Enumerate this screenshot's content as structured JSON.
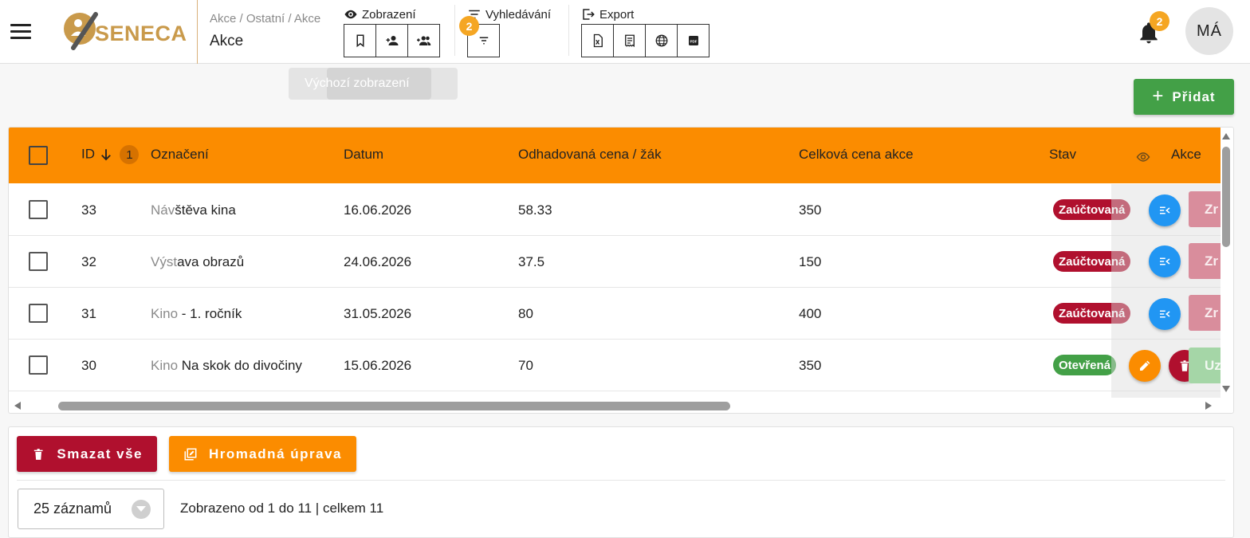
{
  "header": {
    "logo_text": "SENECA",
    "breadcrumb": "Akce / Ostatní / Akce",
    "page_title": "Akce",
    "view_group_label": "Zobrazení",
    "search_group_label": "Vyhledávání",
    "search_filter_count": "2",
    "export_group_label": "Export",
    "notification_count": "2",
    "user_initials": "MÁ"
  },
  "tooltip": {
    "text": "Výchozí zobrazení"
  },
  "add_button": {
    "label": "Přidat"
  },
  "table": {
    "columns": {
      "id": "ID",
      "id_sort_order": "1",
      "label": "Označení",
      "date": "Datum",
      "estimated_price": "Odhadovaná cena / žák",
      "total_price": "Celková cena akce",
      "status": "Stav",
      "actions": "Akce"
    },
    "rows": [
      {
        "id": "33",
        "label_prefix": "Náv",
        "label_rest": "štěva kina",
        "date": "16.06.2026",
        "estimated_price": "58.33",
        "total_price": "350",
        "status": "Zaúčtovaná",
        "cut_label": "Zr"
      },
      {
        "id": "32",
        "label_prefix": "Výst",
        "label_rest": "ava obrazů",
        "date": "24.06.2026",
        "estimated_price": "37.5",
        "total_price": "150",
        "status": "Zaúčtovaná",
        "cut_label": "Zr"
      },
      {
        "id": "31",
        "label_prefix": "Kino",
        "label_rest": " - 1. ročník",
        "date": "31.05.2026",
        "estimated_price": "80",
        "total_price": "400",
        "status": "Zaúčtovaná",
        "cut_label": "Zr"
      },
      {
        "id": "30",
        "label_prefix": "Kino",
        "label_rest": " Na skok do divočiny",
        "date": "15.06.2026",
        "estimated_price": "70",
        "total_price": "350",
        "status": "Otevřená",
        "cut_label": "Uz"
      }
    ]
  },
  "footer": {
    "delete_all_label": "Smazat vše",
    "bulk_edit_label": "Hromadná úprava",
    "page_size_label": "25 záznamů",
    "records_info": "Zobrazeno od 1 do 11 | celkem 11"
  },
  "colors": {
    "header_accent": "#fb8c00",
    "status_posted": "#b0102e",
    "status_open": "#43a047",
    "add_button": "#43a047",
    "detail_button": "#2196f3"
  },
  "icons": {
    "menu": "hamburger-icon",
    "view": [
      "bookmark-icon",
      "person-add-icon",
      "group-add-icon"
    ],
    "search": [
      "filter-icon"
    ],
    "export": [
      "excel-icon",
      "receipt-icon",
      "globe-icon",
      "pdf-icon"
    ],
    "notifications": "bell-icon"
  }
}
